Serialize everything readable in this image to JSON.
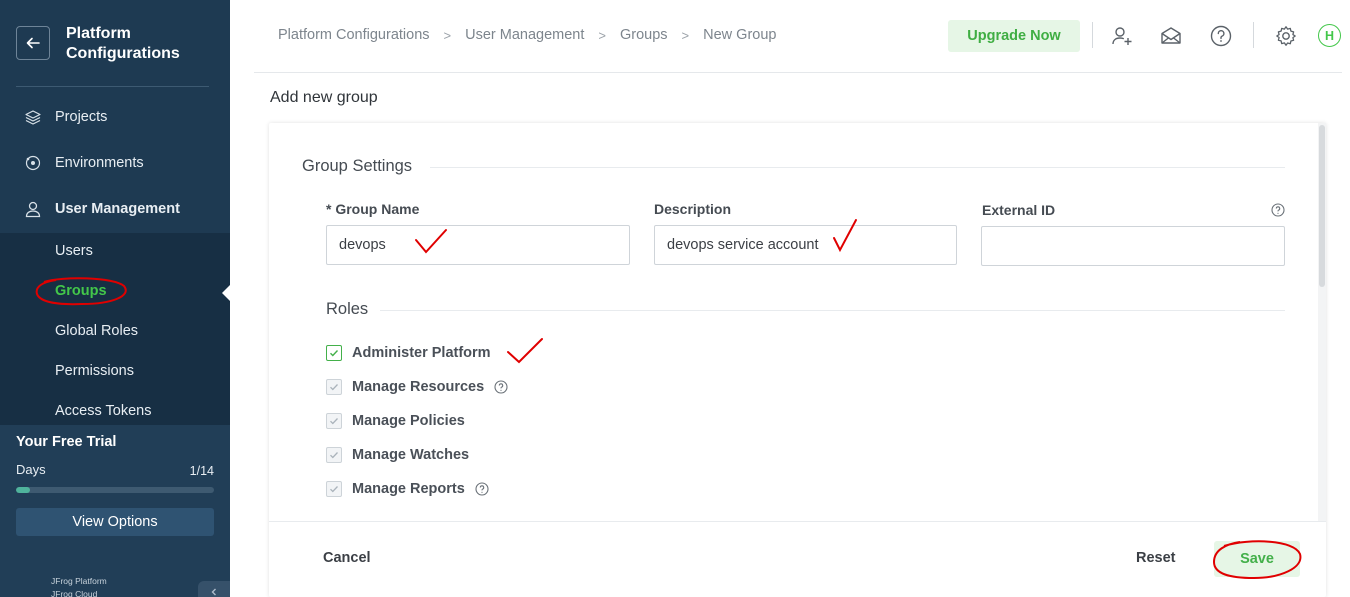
{
  "sidebar": {
    "title": "Platform Configurations",
    "nav": {
      "projects": "Projects",
      "environments": "Environments",
      "user_management": "User Management"
    },
    "sub_items": [
      "Users",
      "Groups",
      "Global Roles",
      "Permissions",
      "Access Tokens"
    ],
    "active_sub_item": "Groups",
    "trial": {
      "title": "Your Free Trial",
      "days_label": "Days",
      "days_count": "1/14",
      "progress_fraction": 0.07,
      "view_options": "View Options"
    },
    "brand_line_1": "JFrog Platform",
    "brand_line_2": "JFrog Cloud"
  },
  "topbar": {
    "breadcrumb": [
      "Platform Configurations",
      "User Management",
      "Groups",
      "New Group"
    ],
    "upgrade_label": "Upgrade Now",
    "avatar_initial": "H",
    "icons": [
      "add-user-icon",
      "mail-icon",
      "help-icon",
      "gear-icon"
    ]
  },
  "page": {
    "title": "Add new group"
  },
  "form": {
    "section_settings": "Group Settings",
    "group_name_label": "* Group Name",
    "group_name_value": "devops",
    "description_label": "Description",
    "description_value": "devops service account",
    "external_id_label": "External ID",
    "external_id_value": "",
    "section_roles": "Roles",
    "roles": [
      {
        "label": "Administer Platform",
        "checked": true,
        "help": false
      },
      {
        "label": "Manage Resources",
        "checked": true,
        "help": true
      },
      {
        "label": "Manage Policies",
        "checked": true,
        "help": false
      },
      {
        "label": "Manage Watches",
        "checked": true,
        "help": false
      },
      {
        "label": "Manage Reports",
        "checked": true,
        "help": true
      }
    ]
  },
  "footer": {
    "cancel": "Cancel",
    "reset": "Reset",
    "save": "Save"
  },
  "colors": {
    "sidebar_bg": "#1e3a52",
    "accent_green": "#43c74a",
    "annotation_red": "#e00000"
  }
}
